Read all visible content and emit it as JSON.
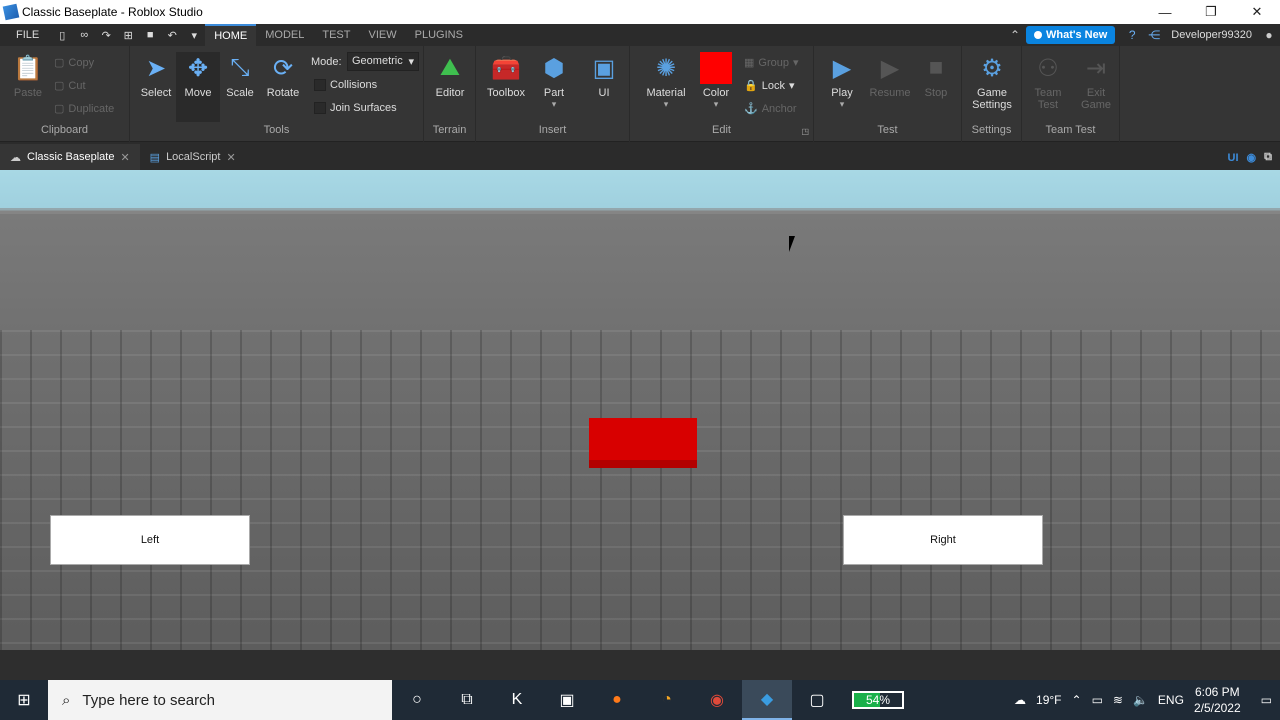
{
  "window": {
    "title": "Classic Baseplate - Roblox Studio"
  },
  "menubar": {
    "file": "FILE",
    "tabs": [
      "HOME",
      "MODEL",
      "TEST",
      "VIEW",
      "PLUGINS"
    ],
    "whats_new": "What's New",
    "user": "Developer99320"
  },
  "ribbon": {
    "clipboard": {
      "paste": "Paste",
      "copy": "Copy",
      "cut": "Cut",
      "duplicate": "Duplicate",
      "label": "Clipboard"
    },
    "tools": {
      "select": "Select",
      "move": "Move",
      "scale": "Scale",
      "rotate": "Rotate",
      "mode_label": "Mode:",
      "mode_value": "Geometric",
      "collisions": "Collisions",
      "join_surfaces": "Join Surfaces",
      "label": "Tools"
    },
    "terrain": {
      "editor": "Editor",
      "label": "Terrain"
    },
    "insert": {
      "toolbox": "Toolbox",
      "part": "Part",
      "ui": "UI",
      "label": "Insert"
    },
    "edit": {
      "material": "Material",
      "color": "Color",
      "group": "Group",
      "lock": "Lock",
      "anchor": "Anchor",
      "label": "Edit",
      "color_swatch": "#ff0000"
    },
    "test": {
      "play": "Play",
      "resume": "Resume",
      "stop": "Stop",
      "label": "Test"
    },
    "settings": {
      "game_settings_1": "Game",
      "game_settings_2": "Settings",
      "label": "Settings"
    },
    "team_test": {
      "team_test_1": "Team",
      "team_test_2": "Test",
      "exit_game_1": "Exit",
      "exit_game_2": "Game",
      "label": "Team Test"
    }
  },
  "doctabs": [
    {
      "label": "Classic Baseplate"
    },
    {
      "label": "LocalScript"
    }
  ],
  "doctabs_right": {
    "ui_toggle": "UI"
  },
  "viewport": {
    "left_button": "Left",
    "right_button": "Right",
    "part_color": "#d80000"
  },
  "taskbar": {
    "search_placeholder": "Type here to search",
    "battery": "54%",
    "weather": "19°F",
    "language": "ENG",
    "time": "6:06 PM",
    "date": "2/5/2022"
  }
}
